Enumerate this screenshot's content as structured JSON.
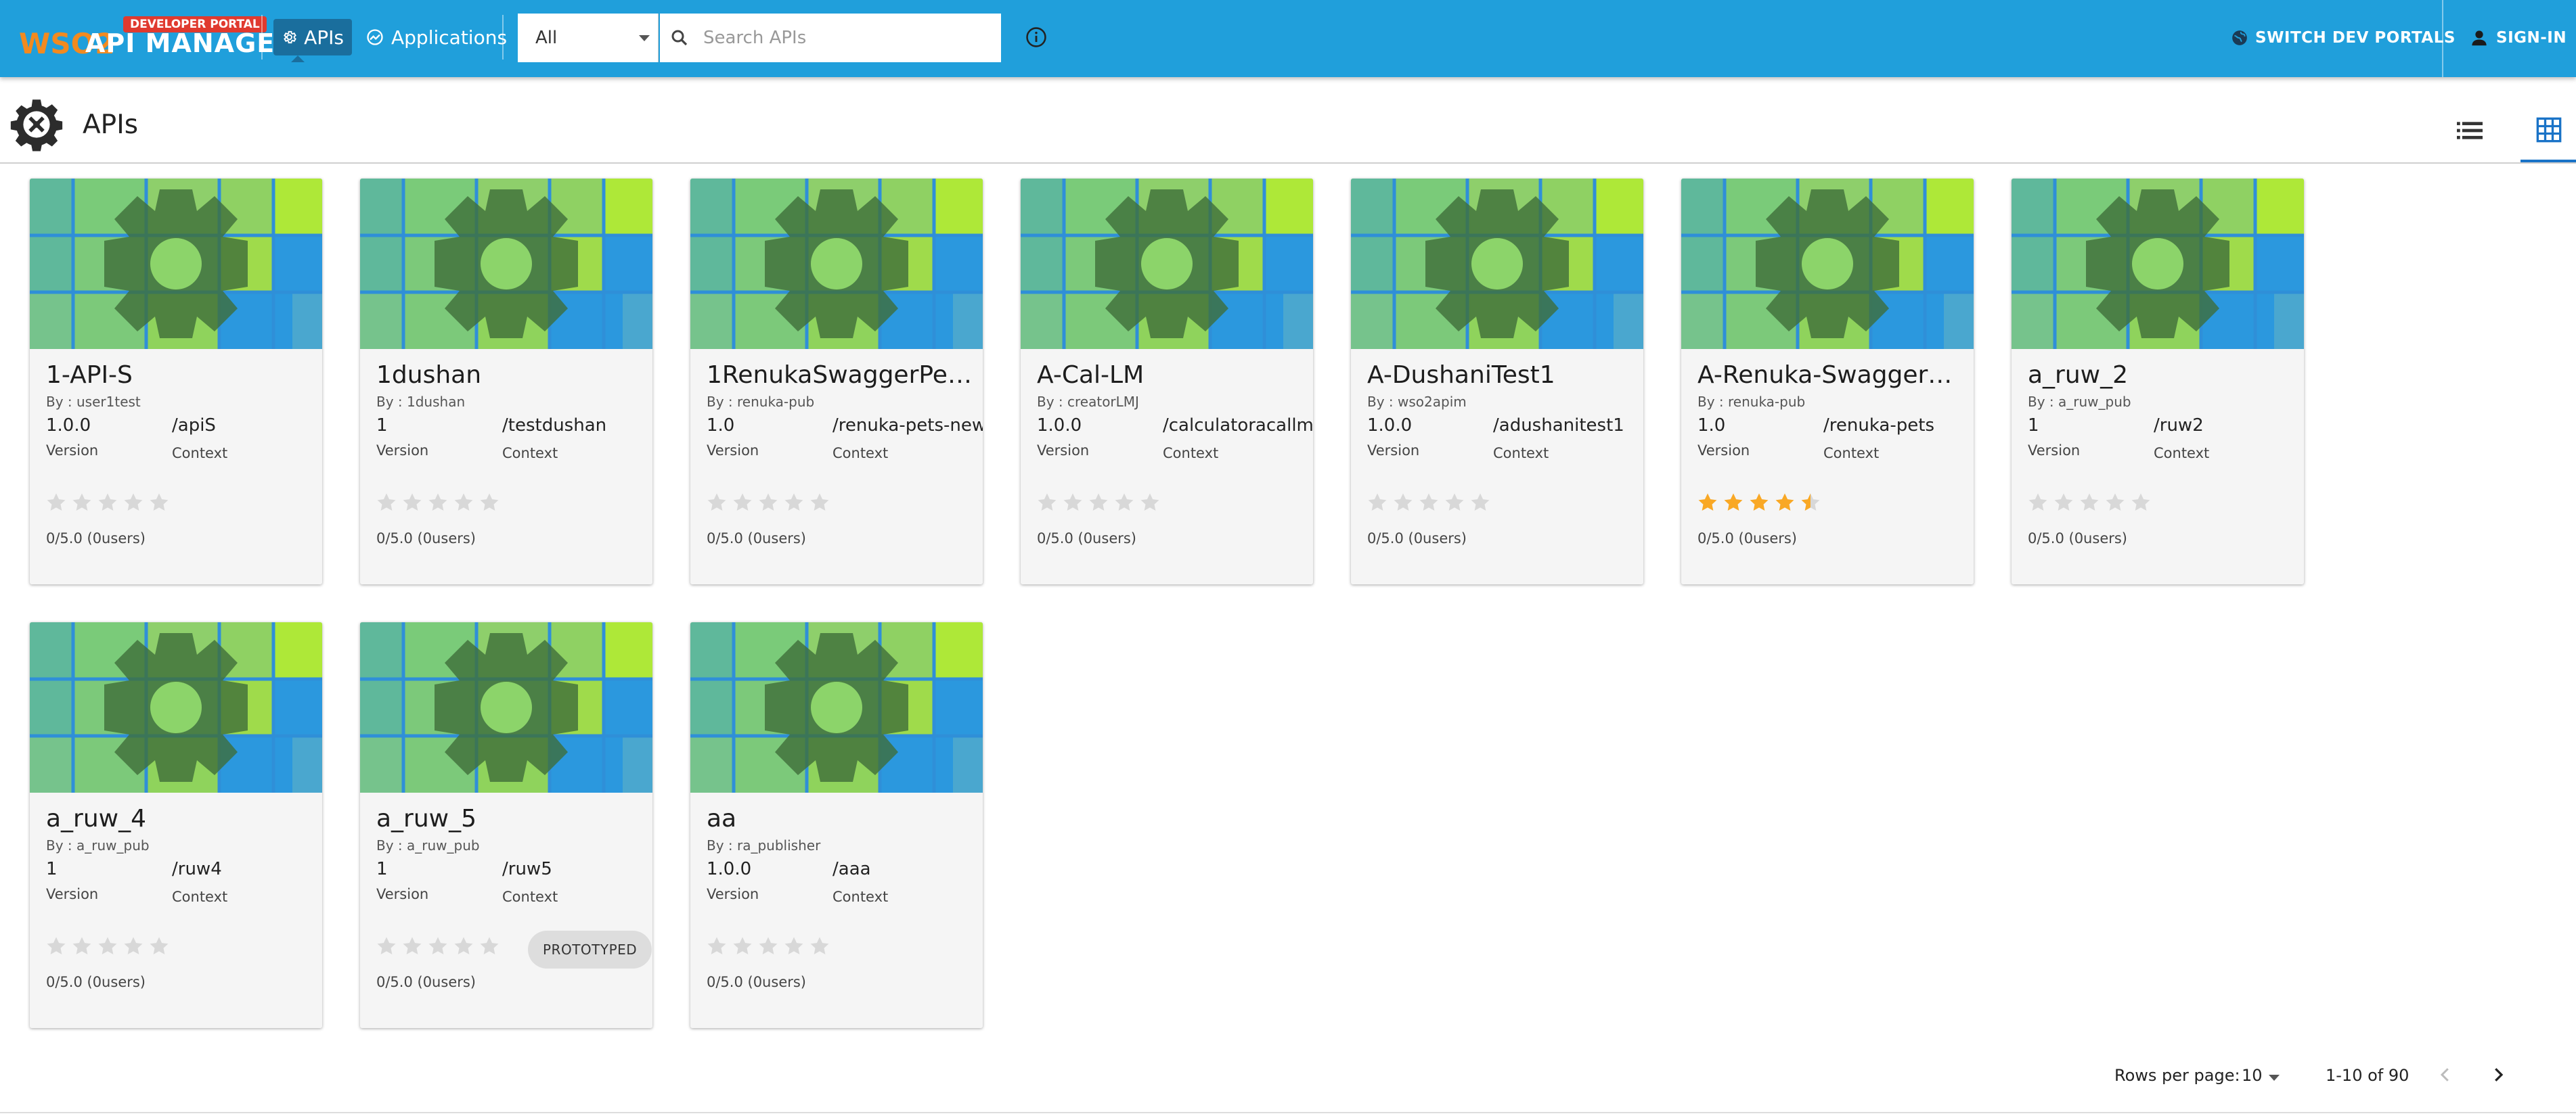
{
  "header": {
    "badge": "DEVELOPER PORTAL",
    "logo_brand": "WSO2",
    "logo_text": "API MANAGER",
    "nav": [
      {
        "label": "APIs",
        "active": true
      },
      {
        "label": "Applications",
        "active": false
      }
    ],
    "filter_value": "All",
    "search_placeholder": "Search APIs",
    "switch_label": "SWITCH DEV PORTALS",
    "signin_label": "SIGN-IN"
  },
  "page": {
    "title": "APIs"
  },
  "labels": {
    "version": "Version",
    "context": "Context"
  },
  "cards": [
    {
      "name": "1-API-S",
      "by": "By : user1test",
      "version": "1.0.0",
      "context": "/apiS",
      "rating": "0/5.0 (0users)",
      "stars": 0,
      "chip": ""
    },
    {
      "name": "1dushan",
      "by": "By : 1dushan",
      "version": "1",
      "context": "/testdushan",
      "rating": "0/5.0 (0users)",
      "stars": 0,
      "chip": ""
    },
    {
      "name": "1RenukaSwaggerPet…",
      "by": "By : renuka-pub",
      "version": "1.0",
      "context": "/renuka-pets-new",
      "rating": "0/5.0 (0users)",
      "stars": 0,
      "chip": ""
    },
    {
      "name": "A-Cal-LM",
      "by": "By : creatorLMJ",
      "version": "1.0.0",
      "context": "/calculatoracallm",
      "rating": "0/5.0 (0users)",
      "stars": 0,
      "chip": ""
    },
    {
      "name": "A-DushaniTest1",
      "by": "By : wso2apim",
      "version": "1.0.0",
      "context": "/adushanitest1",
      "rating": "0/5.0 (0users)",
      "stars": 0,
      "chip": ""
    },
    {
      "name": "A-Renuka-SwaggerP…",
      "by": "By : renuka-pub",
      "version": "1.0",
      "context": "/renuka-pets",
      "rating": "0/5.0 (0users)",
      "stars": 4.5,
      "chip": ""
    },
    {
      "name": "a_ruw_2",
      "by": "By : a_ruw_pub",
      "version": "1",
      "context": "/ruw2",
      "rating": "0/5.0 (0users)",
      "stars": 0,
      "chip": ""
    },
    {
      "name": "a_ruw_4",
      "by": "By : a_ruw_pub",
      "version": "1",
      "context": "/ruw4",
      "rating": "0/5.0 (0users)",
      "stars": 0,
      "chip": ""
    },
    {
      "name": "a_ruw_5",
      "by": "By : a_ruw_pub",
      "version": "1",
      "context": "/ruw5",
      "rating": "0/5.0 (0users)",
      "stars": 0,
      "chip": "PROTOTYPED"
    },
    {
      "name": "aa",
      "by": "By : ra_publisher",
      "version": "1.0.0",
      "context": "/aaa",
      "rating": "0/5.0 (0users)",
      "stars": 0,
      "chip": ""
    }
  ],
  "pagination": {
    "rows_label": "Rows per page:",
    "rows_value": "10",
    "range": "1-10 of 90"
  },
  "colors": {
    "topbar": "#209fdb",
    "star_filled": "#f9a825",
    "star_empty": "#d8d8d8",
    "accent": "#1a73c7"
  },
  "icons": [
    "gear-icon",
    "applications-icon",
    "search-icon",
    "info-icon",
    "globe-icon",
    "person-icon",
    "list-view-icon",
    "grid-view-icon",
    "chevron-left-icon",
    "chevron-right-icon",
    "star-icon"
  ]
}
